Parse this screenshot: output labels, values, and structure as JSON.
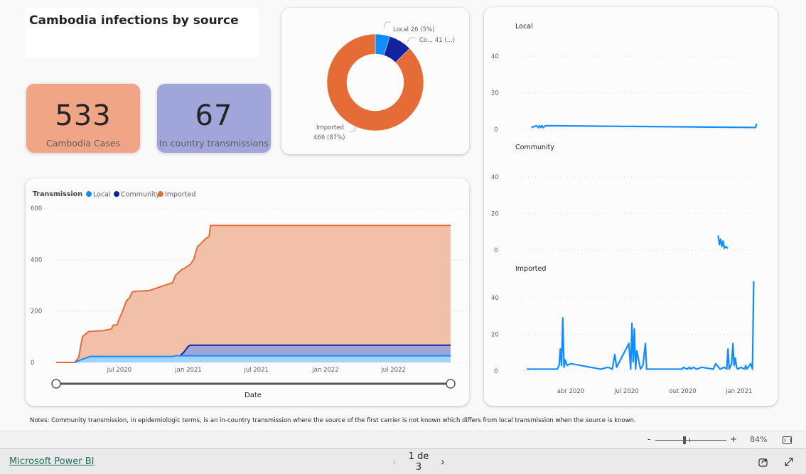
{
  "title": "Cambodia infections by source",
  "kpis": {
    "cases": {
      "value": "533",
      "label": "Cambodia Cases",
      "color": "#f0a586"
    },
    "transmissions": {
      "value": "67",
      "label": "In country transmissions",
      "color": "#a0a6da"
    }
  },
  "colors": {
    "local": "#118dff",
    "community": "#12239e",
    "imported": "#e66c37"
  },
  "notes": "Notes: Community transmission, in epidemiologic terms, is an in-country transmission where the source of the first carrier is not known which differs from local transmission when the source is known.",
  "zoom": {
    "minus": "-",
    "plus": "+",
    "percent": "84%",
    "level": 0.84
  },
  "footer": {
    "brand": "Microsoft Power BI",
    "page_indicator": "1 de 3",
    "prev": "‹",
    "next": "›"
  },
  "chart_data": [
    {
      "type": "pie",
      "subtype": "donut",
      "labels": [
        "Local",
        "Community",
        "Imported"
      ],
      "values": [
        26,
        41,
        466
      ],
      "data_labels": [
        "Local 26 (5%)",
        "Co... 41 (...)",
        "Imported",
        "466 (87%)"
      ],
      "colors": [
        "#118dff",
        "#12239e",
        "#e66c37"
      ]
    },
    {
      "type": "area",
      "title": "",
      "legend_title": "Transmission",
      "legend": [
        "Local",
        "Community",
        "Imported"
      ],
      "legend_position": "top-left",
      "xlabel": "Date",
      "ylabel": "",
      "ylim": [
        0,
        600
      ],
      "yticks": [
        0,
        200,
        400,
        600
      ],
      "xticks": [
        "jul 2020",
        "jan 2021",
        "jul 2021",
        "jan 2022",
        "jul 2022"
      ],
      "x_range": [
        "2020-01",
        "2022-12"
      ],
      "grid": true,
      "series": [
        {
          "name": "Imported",
          "x": [
            "2020-01-15",
            "2020-03-05",
            "2020-03-15",
            "2020-03-25",
            "2020-04-10",
            "2020-05-20",
            "2020-06-10",
            "2020-06-15",
            "2020-06-25",
            "2020-07-01",
            "2020-07-10",
            "2020-07-20",
            "2020-07-28",
            "2020-08-05",
            "2020-08-10",
            "2020-09-20",
            "2020-10-10",
            "2020-10-30",
            "2020-11-20",
            "2020-11-28",
            "2020-12-15",
            "2020-12-20",
            "2021-01-05",
            "2021-01-15",
            "2021-01-25",
            "2021-02-05",
            "2021-02-15",
            "2021-02-25",
            "2021-03-01",
            "2022-11-30"
          ],
          "values": [
            0,
            0,
            20,
            100,
            120,
            124,
            130,
            145,
            145,
            170,
            200,
            240,
            250,
            275,
            276,
            280,
            290,
            300,
            310,
            340,
            362,
            365,
            380,
            400,
            450,
            465,
            480,
            490,
            533,
            533
          ]
        },
        {
          "name": "Community",
          "x": [
            "2020-12-10",
            "2020-12-20",
            "2020-12-30",
            "2021-01-05",
            "2022-11-30"
          ],
          "values": [
            26,
            40,
            60,
            67,
            67
          ]
        },
        {
          "name": "Local",
          "x": [
            "2020-03-05",
            "2020-03-20",
            "2020-04-05",
            "2020-04-15",
            "2020-11-20",
            "2020-11-25",
            "2022-11-30"
          ],
          "values": [
            0,
            10,
            18,
            23,
            23,
            26,
            26
          ]
        }
      ]
    },
    {
      "type": "line",
      "title": "Local",
      "ylim": [
        0,
        50
      ],
      "yticks": [
        0,
        20,
        40
      ],
      "x": [
        "2020-01-28",
        "2020-02-05",
        "2020-02-08",
        "2020-02-10",
        "2020-02-12",
        "2020-02-14",
        "2020-02-16",
        "2020-02-20",
        "2021-01-28",
        "2021-01-30"
      ],
      "values": [
        1,
        2,
        1,
        2,
        1,
        2,
        1,
        2,
        1,
        3
      ]
    },
    {
      "type": "line",
      "title": "Community",
      "ylim": [
        0,
        50
      ],
      "yticks": [
        0,
        20,
        40
      ],
      "x": [
        "2020-11-28",
        "2020-11-30",
        "2020-12-02",
        "2020-12-04",
        "2020-12-06",
        "2020-12-08",
        "2020-12-10",
        "2020-12-14"
      ],
      "values": [
        8,
        3,
        6,
        2,
        5,
        1,
        2,
        1
      ]
    },
    {
      "type": "line",
      "title": "Imported",
      "ylim": [
        0,
        50
      ],
      "yticks": [
        0,
        20,
        40
      ],
      "xticks": [
        "abr 2020",
        "jul 2020",
        "out 2020",
        "jan 2021"
      ],
      "x": [
        "2020-01-20",
        "2020-03-10",
        "2020-03-13",
        "2020-03-15",
        "2020-03-17",
        "2020-03-19",
        "2020-03-21",
        "2020-03-23",
        "2020-03-26",
        "2020-04-01",
        "2020-05-20",
        "2020-06-01",
        "2020-06-08",
        "2020-06-12",
        "2020-06-15",
        "2020-07-05",
        "2020-07-08",
        "2020-07-10",
        "2020-07-12",
        "2020-07-14",
        "2020-07-16",
        "2020-07-18",
        "2020-07-24",
        "2020-07-28",
        "2020-08-01",
        "2020-08-03",
        "2020-08-05",
        "2020-09-30",
        "2020-10-02",
        "2020-10-08",
        "2020-10-12",
        "2020-10-14",
        "2020-10-18",
        "2020-10-24",
        "2020-11-01",
        "2020-11-20",
        "2020-11-24",
        "2020-12-01",
        "2020-12-08",
        "2020-12-12",
        "2020-12-14",
        "2020-12-16",
        "2020-12-20",
        "2020-12-22",
        "2020-12-24",
        "2020-12-26",
        "2020-12-28",
        "2020-12-30",
        "2021-01-04",
        "2021-01-10",
        "2021-01-12",
        "2021-01-14",
        "2021-01-20",
        "2021-01-23",
        "2021-01-25"
      ],
      "values": [
        1,
        1,
        3,
        12,
        3,
        29,
        2,
        6,
        3,
        4,
        1,
        2,
        1,
        9,
        2,
        15,
        1,
        26,
        5,
        23,
        1,
        11,
        1,
        3,
        15,
        1,
        1,
        1,
        2,
        1,
        2,
        1,
        2,
        1,
        2,
        1,
        4,
        1,
        2,
        1,
        12,
        1,
        4,
        15,
        3,
        7,
        2,
        1,
        2,
        1,
        3,
        1,
        4,
        1,
        49
      ]
    }
  ]
}
